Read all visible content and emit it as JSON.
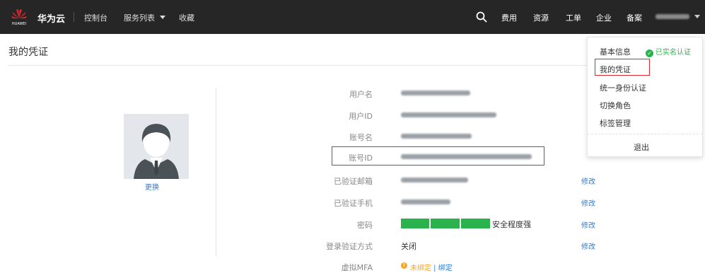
{
  "topbar": {
    "brand": "华为云",
    "logo_text": "HUAWEI",
    "nav": {
      "console": "控制台",
      "services": "服务列表",
      "favorites": "收藏"
    },
    "right": {
      "billing": "费用",
      "resources": "资源",
      "tickets": "工单",
      "enterprise": "企业",
      "filing": "备案"
    },
    "icons": [
      "search-icon",
      "chevron-down-icon",
      "huawei-logo"
    ]
  },
  "page": {
    "title": "我的凭证"
  },
  "profile": {
    "change_avatar": "更换"
  },
  "fields": {
    "username_label": "用户名",
    "userid_label": "用户ID",
    "account_name_label": "账号名",
    "account_id_label": "账号ID",
    "email_label": "已验证邮箱",
    "phone_label": "已验证手机",
    "password_label": "密码",
    "login_auth_label": "登录验证方式",
    "mfa_label": "虚拟MFA"
  },
  "values": {
    "password_strength": "安全程度强",
    "password_strength_level": 3,
    "login_auth_value": "关闭",
    "mfa_status": "未绑定",
    "mfa_separator": " | ",
    "mfa_bind": "绑定"
  },
  "actions": {
    "edit": "修改"
  },
  "dropdown": {
    "basic_info": "基本信息",
    "verified": "已实名认证",
    "my_credentials": "我的凭证",
    "unified_identity": "统一身份认证",
    "switch_role": "切换角色",
    "tag_management": "标签管理",
    "logout": "退出"
  },
  "colors": {
    "accent": "#2b7bd8",
    "highlight": "#e0262d",
    "strength": "#2ab34d",
    "topbar": "#262626",
    "warning": "#f5a623"
  }
}
